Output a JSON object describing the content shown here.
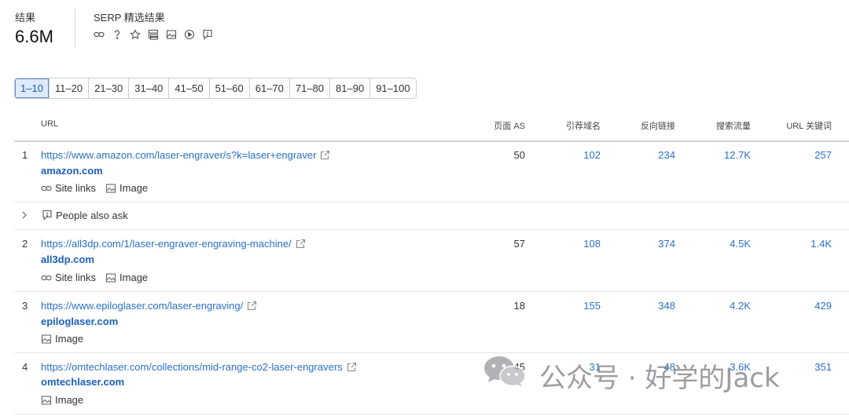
{
  "summary": {
    "results_label": "结果",
    "results_value": "6.6M",
    "serp_label": "SERP 精选结果"
  },
  "serp_icons": [
    "link-icon",
    "question-icon",
    "star-icon",
    "sitelinks-icon",
    "image-icon",
    "video-icon",
    "comment-icon"
  ],
  "pagination": {
    "pages": [
      "1–10",
      "11–20",
      "21–30",
      "31–40",
      "41–50",
      "51–60",
      "61–70",
      "71–80",
      "81–90",
      "91–100"
    ],
    "active_index": 0
  },
  "columns": {
    "url": "URL",
    "page_as": "页面 AS",
    "ref_domains": "引荐域名",
    "backlinks": "反向链接",
    "traffic": "搜索流量",
    "url_keywords": "URL 关键词"
  },
  "rows": [
    {
      "rank": "1",
      "url": "https://www.amazon.com/laser-engraver/s?k=laser+engraver",
      "domain": "amazon.com",
      "features": [
        "Site links",
        "Image"
      ],
      "page_as": "50",
      "ref_domains": "102",
      "backlinks": "234",
      "traffic": "12.7K",
      "url_keywords": "257"
    },
    {
      "rank": "2",
      "url": "https://all3dp.com/1/laser-engraver-engraving-machine/",
      "domain": "all3dp.com",
      "features": [
        "Site links",
        "Image"
      ],
      "page_as": "57",
      "ref_domains": "108",
      "backlinks": "374",
      "traffic": "4.5K",
      "url_keywords": "1.4K"
    },
    {
      "rank": "3",
      "url": "https://www.epiloglaser.com/laser-engraving/",
      "domain": "epiloglaser.com",
      "features": [
        "Image"
      ],
      "page_as": "18",
      "ref_domains": "155",
      "backlinks": "348",
      "traffic": "4.2K",
      "url_keywords": "429"
    },
    {
      "rank": "4",
      "url": "https://omtechlaser.com/collections/mid-range-co2-laser-engravers",
      "domain": "omtechlaser.com",
      "features": [
        "Image"
      ],
      "page_as": "45",
      "ref_domains": "31",
      "backlinks": "48",
      "traffic": "3.6K",
      "url_keywords": "351"
    }
  ],
  "people_also_ask": {
    "label": "People also ask"
  },
  "watermark": {
    "text": "公众号 · 好学的Jack"
  },
  "colors": {
    "link": "#2a6fc9",
    "domain": "#1a5fbf",
    "active_page_bg": "#dceafb",
    "border": "#c9cdd4"
  }
}
